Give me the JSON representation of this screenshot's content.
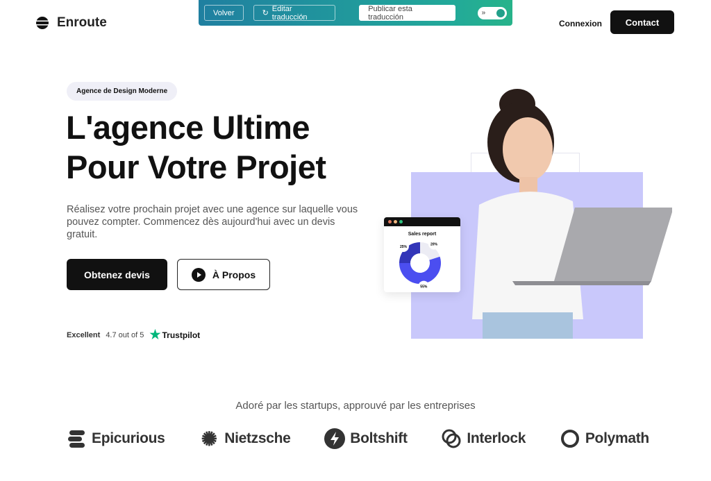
{
  "brand": {
    "name": "Enroute"
  },
  "toolbar": {
    "back": "Volver",
    "edit": "Editar traducción",
    "publish": "Publicar esta traducción",
    "toggle_icon": "»"
  },
  "nav": {
    "login": "Connexion",
    "contact": "Contact"
  },
  "hero": {
    "badge": "Agence de Design Moderne",
    "title_line1": "L'agence Ultime",
    "title_line2": "Pour Votre Projet",
    "subtitle": "Réalisez votre prochain projet avec une agence sur laquelle vous pouvez compter. Commencez dès aujourd'hui avec un devis gratuit.",
    "cta_primary": "Obtenez devis",
    "cta_secondary": "À Propos"
  },
  "rating": {
    "label": "Excellent",
    "score": "4.7 out of 5",
    "brand": "Trustpilot"
  },
  "sales_card": {
    "title": "Sales report",
    "segments": [
      {
        "label": "20%",
        "value": 20
      },
      {
        "label": "55%",
        "value": 55
      },
      {
        "label": "25%",
        "value": 25
      }
    ]
  },
  "colors": {
    "accent": "#4b4ef0",
    "dark": "#111111",
    "trustpilot": "#00b67a",
    "toolbar_start": "#1f7fa0",
    "toolbar_end": "#27b38a"
  },
  "social_proof": {
    "tagline": "Adoré par les startups, approuvé par les entreprises",
    "logos": [
      "Epicurious",
      "Nietzsche",
      "Boltshift",
      "Interlock",
      "Polymath"
    ]
  }
}
